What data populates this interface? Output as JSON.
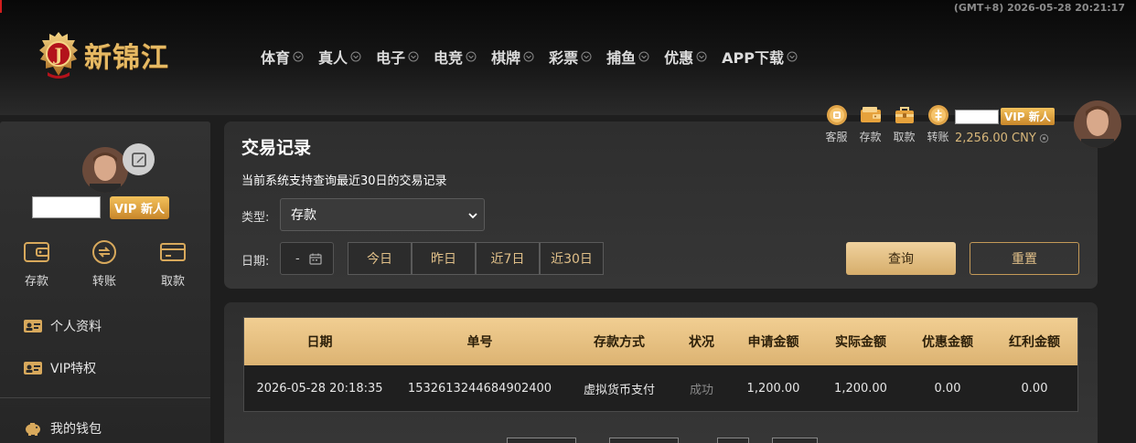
{
  "header": {
    "time": "(GMT+8) 2026-05-28 20:21:17",
    "logo_text": "新锦江",
    "nav": [
      {
        "label": "体育"
      },
      {
        "label": "真人"
      },
      {
        "label": "电子"
      },
      {
        "label": "电竞"
      },
      {
        "label": "棋牌"
      },
      {
        "label": "彩票"
      },
      {
        "label": "捕鱼"
      },
      {
        "label": "优惠"
      },
      {
        "label": "APP下载"
      }
    ]
  },
  "toolbar": {
    "service": "客服",
    "deposit": "存款",
    "withdraw": "取款",
    "transfer": "转账",
    "vip": "VIP 新人",
    "balance": "2,256.00 CNY"
  },
  "sidebar": {
    "vip": "VIP 新人",
    "quick": {
      "deposit": "存款",
      "transfer": "转账",
      "withdraw": "取款"
    },
    "menu": {
      "profile": "个人资料",
      "vip": "VIP特权",
      "wallet": "我的钱包"
    }
  },
  "filter": {
    "title": "交易记录",
    "note": "当前系统支持查询最近30日的交易记录",
    "type_label": "类型:",
    "type_value": "存款",
    "date_label": "日期:",
    "date_value": "-",
    "ranges": [
      "今日",
      "昨日",
      "近7日",
      "近30日"
    ],
    "query": "查询",
    "reset": "重置"
  },
  "table": {
    "headers": [
      "日期",
      "单号",
      "存款方式",
      "状况",
      "申请金额",
      "实际金额",
      "优惠金额",
      "红利金额"
    ],
    "rows": [
      [
        "2026-05-28 20:18:35",
        "1532613244684902400",
        "虚拟货币支付",
        "成功",
        "1,200.00",
        "1,200.00",
        "0.00",
        "0.00"
      ]
    ]
  },
  "colors": {
    "gold": "#e1c089",
    "gold_dark": "#c8862a",
    "background": "#1e1e1e"
  }
}
